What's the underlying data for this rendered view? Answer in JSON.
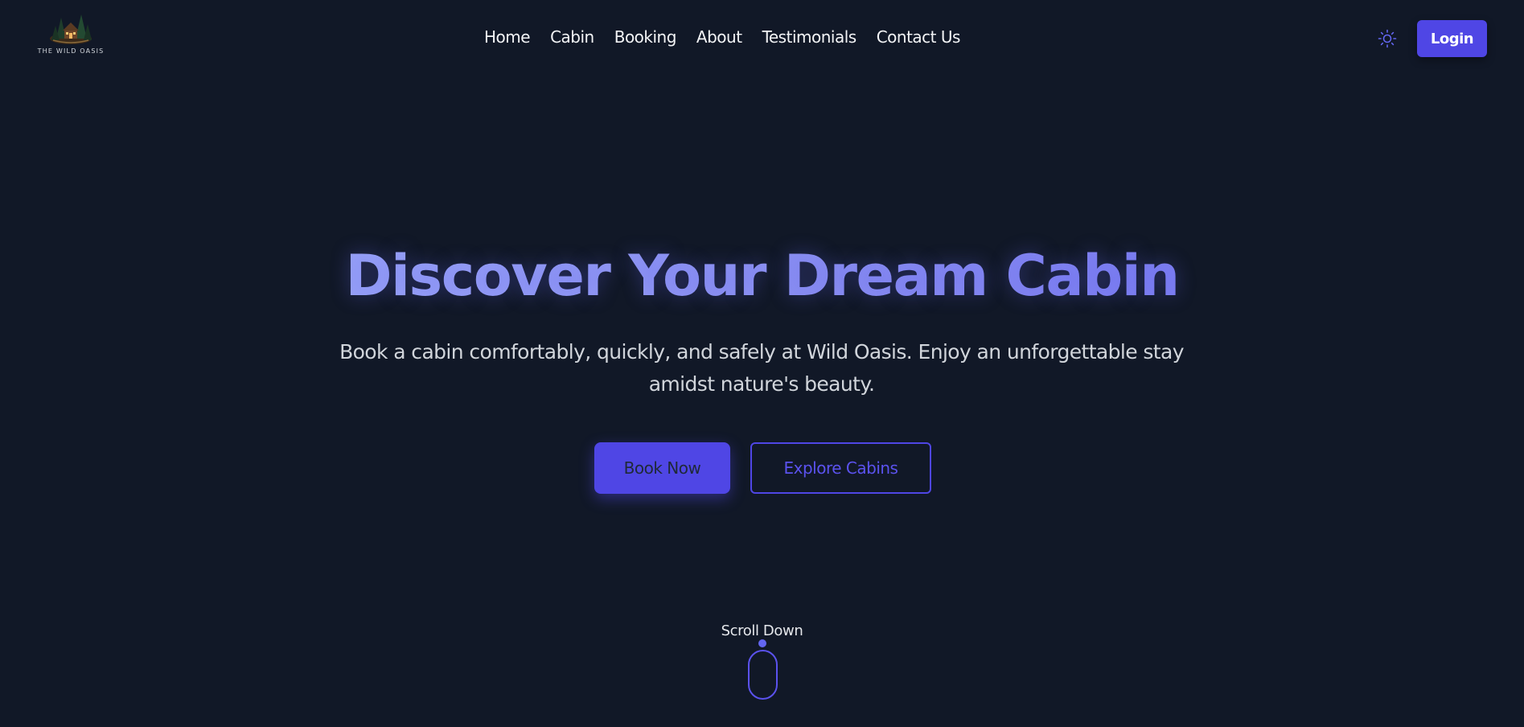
{
  "brand": {
    "name": "THE WILD OASIS",
    "logo_icon": "cabin-forest-logo"
  },
  "nav": {
    "items": [
      {
        "label": "Home"
      },
      {
        "label": "Cabin"
      },
      {
        "label": "Booking"
      },
      {
        "label": "About"
      },
      {
        "label": "Testimonials"
      },
      {
        "label": "Contact Us"
      }
    ]
  },
  "header": {
    "theme_icon": "sun-icon",
    "login_label": "Login"
  },
  "hero": {
    "title": "Discover Your Dream Cabin",
    "subtitle": "Book a cabin comfortably, quickly, and safely at Wild Oasis. Enjoy an unforgettable stay amidst nature's beauty.",
    "primary_button": "Book Now",
    "secondary_button": "Explore Cabins"
  },
  "scroll": {
    "label": "Scroll Down",
    "icon": "mouse-scroll-icon"
  },
  "colors": {
    "background": "#111827",
    "accent": "#4f46e5",
    "title_gradient_start": "#a5b4fc",
    "title_gradient_end": "#6d6cf0",
    "text": "#e5e7eb"
  }
}
